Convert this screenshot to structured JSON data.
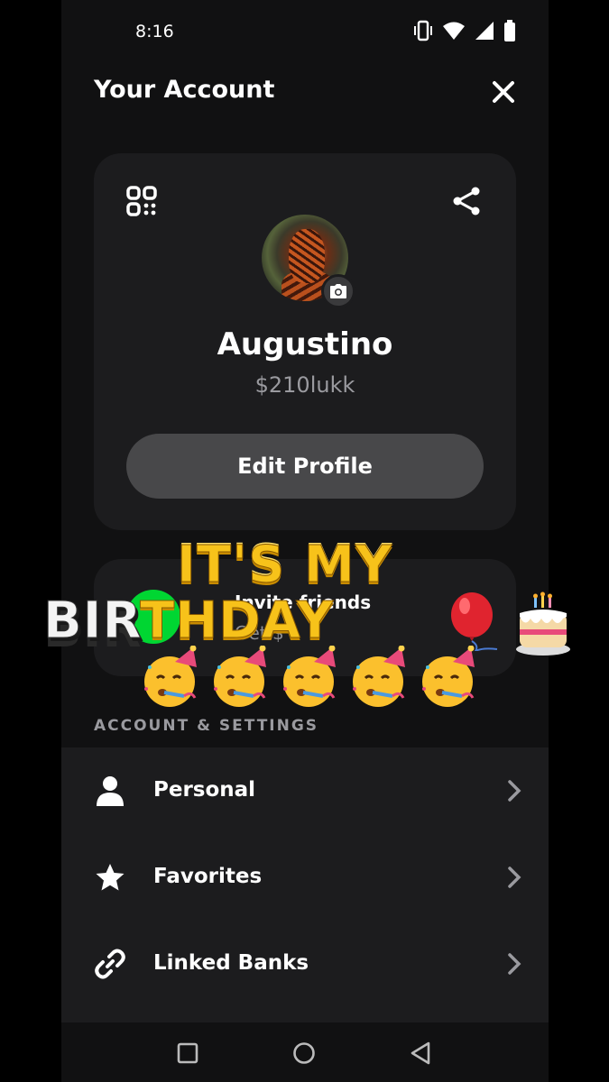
{
  "status_bar": {
    "time": "8:16",
    "icons": [
      "vibrate-icon",
      "wifi-icon",
      "signal-icon",
      "battery-icon"
    ]
  },
  "header": {
    "title": "Your Account",
    "close_icon": "close-icon"
  },
  "profile": {
    "name": "Augustino",
    "cashtag": "$210lukk",
    "edit_label": "Edit Profile",
    "qr_icon": "qr-code-icon",
    "share_icon": "share-icon",
    "camera_icon": "camera-icon"
  },
  "invite": {
    "title": "Invite friends",
    "subtitle": "Get $"
  },
  "account_section": {
    "label": "ACCOUNT & SETTINGS",
    "items": [
      {
        "label": "Personal",
        "icon": "person-icon"
      },
      {
        "label": "Favorites",
        "icon": "star-icon"
      },
      {
        "label": "Linked Banks",
        "icon": "link-icon"
      }
    ]
  },
  "overlay": {
    "line1": "IT'S MY",
    "line2_white": "BIR",
    "line2_gold": "THDAY",
    "emoji": [
      "balloon",
      "birthday-cake",
      "partying-face"
    ]
  },
  "colors": {
    "background": "#111112",
    "card": "#1c1c1e",
    "accent_green": "#00d632",
    "muted_text": "#9a9a9f"
  }
}
